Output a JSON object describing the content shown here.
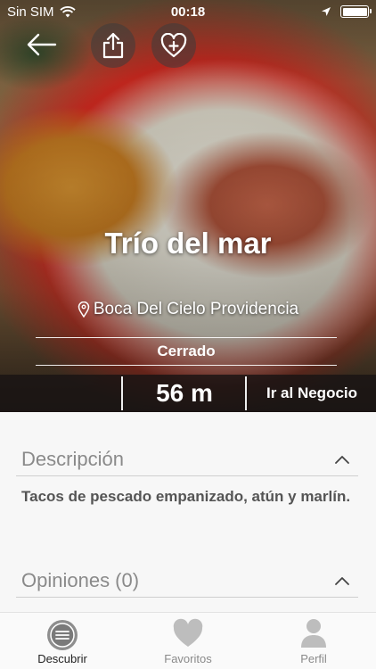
{
  "status_bar": {
    "carrier": "Sin SIM",
    "time": "00:18"
  },
  "place": {
    "title": "Trío del mar",
    "location": "Boca Del Cielo Providencia",
    "open_status": "Cerrado",
    "distance": "56 m",
    "goto_label": "Ir al Negocio"
  },
  "sections": {
    "description": {
      "title": "Descripción",
      "text": "Tacos de pescado empanizado, atún y marlín."
    },
    "reviews": {
      "title": "Opiniones (0)"
    }
  },
  "tabbar": {
    "tabs": [
      {
        "label": "Descubrir",
        "icon": "menu-circle-icon",
        "active": true
      },
      {
        "label": "Favoritos",
        "icon": "heart-icon",
        "active": false
      },
      {
        "label": "Perfil",
        "icon": "person-icon",
        "active": false
      }
    ]
  },
  "colors": {
    "active_tab": "#222222",
    "inactive_tab": "#8a8a8a",
    "icon_inactive": "#bdbdbd"
  }
}
